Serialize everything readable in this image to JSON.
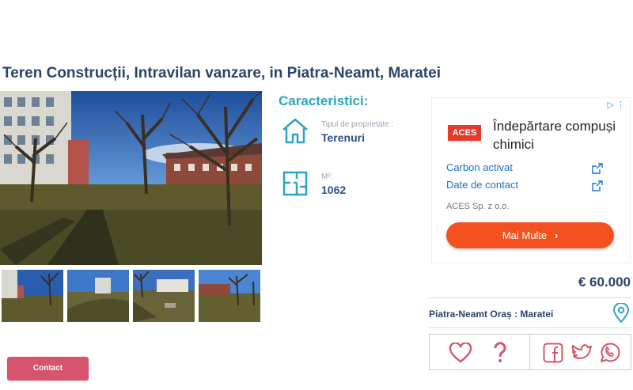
{
  "listing": {
    "title": "Teren Construcții, Intravilan vanzare, in Piatra-Neamt, Maratei",
    "price": "€ 60.000",
    "location": "Piatra-Neamt Oraș : Maratei"
  },
  "features": {
    "heading": "Caracteristici:",
    "items": [
      {
        "icon": "house-icon",
        "label": "Tipul de proprietate :",
        "value": "Terenuri"
      },
      {
        "icon": "floorplan-icon",
        "label": "M²:",
        "value": "1062"
      }
    ]
  },
  "gallery": {
    "thumbnail_count": 4
  },
  "ad": {
    "choices_icon": "adchoices-icon",
    "logo_text": "ACES",
    "headline": "Îndepărtare compuși chimici",
    "links": [
      "Carbon activat",
      "Date de contact"
    ],
    "company": "ACES Sp. z o.o.",
    "cta_label": "Mai Multe",
    "cta_color": "#f4511e"
  },
  "actions": {
    "icons": [
      "heart-icon",
      "question-icon",
      "facebook-icon",
      "twitter-icon",
      "whatsapp-icon"
    ],
    "accent_color": "#d6546c"
  },
  "contact_button": {
    "label": "Contact"
  },
  "colors": {
    "title": "#2c4468",
    "accent": "#2ba5c4",
    "value": "#2c4f8a"
  }
}
